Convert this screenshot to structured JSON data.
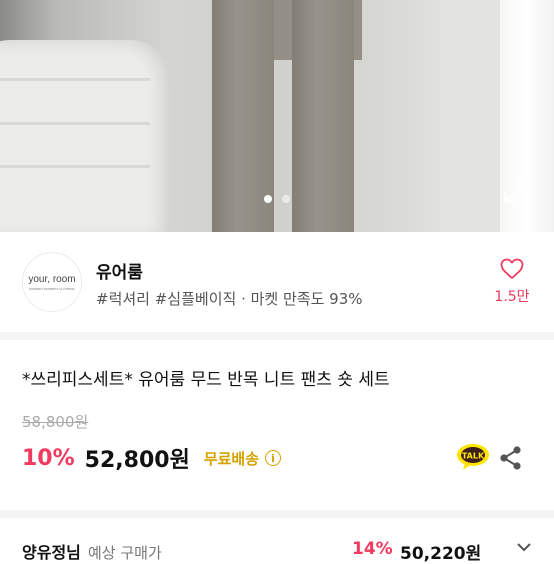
{
  "carousel": {
    "current_index": 0,
    "total": 2
  },
  "shop": {
    "logo_text": "your, room",
    "logo_sub": "MODERN WOMEN'S CLOTHING",
    "name": "유어룸",
    "tags": "#럭셔리 #심플베이직 · 마켓 만족도 93%",
    "like_count": "1.5만"
  },
  "product": {
    "title": "*쓰리피스세트* 유어룸 무드 반목 니트 팬츠 숏 세트",
    "original_price": "58,800원",
    "discount": "10%",
    "price": "52,800원",
    "shipping": "무료배송",
    "info_glyph": "i",
    "talk_label": "TALK"
  },
  "coupon_row": {
    "who": "양유정님",
    "label": "예상 구매가",
    "discount": "14%",
    "price": "50,220원"
  },
  "colors": {
    "accent": "#f03a5f",
    "shipping": "#d4a200",
    "talk_bg": "#3c1e1e",
    "talk_bubble": "#fee500"
  }
}
